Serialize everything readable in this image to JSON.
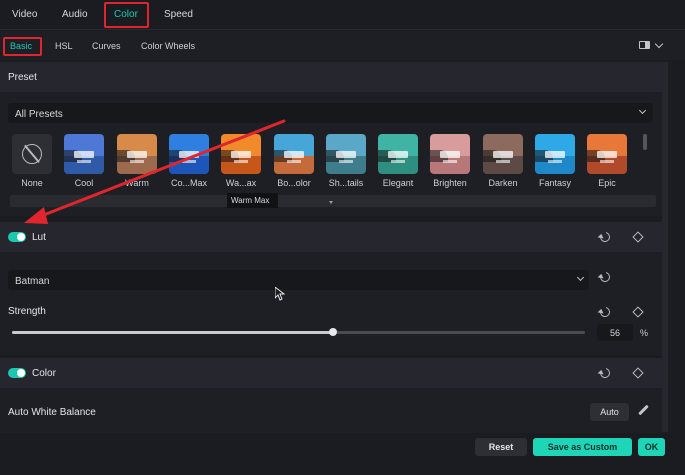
{
  "top_tabs": [
    "Video",
    "Audio",
    "Color",
    "Speed"
  ],
  "sub_tabs": [
    "Basic",
    "HSL",
    "Curves",
    "Color Wheels"
  ],
  "preset_section": {
    "title": "Preset",
    "dropdown_value": "All Presets",
    "presets": [
      {
        "name": "None"
      },
      {
        "name": "Cool",
        "sky": "#4d78d6",
        "sea": "#2f5aa8"
      },
      {
        "name": "Warm",
        "sky": "#d88a4a",
        "sea": "#9e6a4e"
      },
      {
        "name": "Co...Max",
        "sky": "#2f7fe0",
        "sea": "#1d56b8"
      },
      {
        "name": "Wa...ax",
        "sky": "#f08a2a",
        "sea": "#c7561a"
      },
      {
        "name": "Bo...olor",
        "sky": "#46a6d8",
        "sea": "#c56a3a"
      },
      {
        "name": "Sh...tails",
        "sky": "#5aa7c8",
        "sea": "#3e7e8c"
      },
      {
        "name": "Elegant",
        "sky": "#3fb4a4",
        "sea": "#2e8f80"
      },
      {
        "name": "Brighten",
        "sky": "#d89c9c",
        "sea": "#b8787a"
      },
      {
        "name": "Darken",
        "sky": "#8c6a5e",
        "sea": "#5e4a44"
      },
      {
        "name": "Fantasy",
        "sky": "#2fa8e8",
        "sea": "#1e88c8"
      },
      {
        "name": "Epic",
        "sky": "#e8783a",
        "sea": "#b04a2a"
      }
    ],
    "tooltip": "Warm Max"
  },
  "lut_section": {
    "title": "Lut",
    "enabled": true,
    "dropdown_value": "Batman",
    "strength_label": "Strength",
    "strength_value": "56",
    "strength_unit": "%",
    "strength_level": 0.56
  },
  "color_section": {
    "title": "Color",
    "enabled": true,
    "awb_label": "Auto White Balance",
    "auto_button": "Auto"
  },
  "footer": {
    "reset": "Reset",
    "save_custom": "Save as Custom",
    "ok": "OK"
  },
  "colors": {
    "accent": "#1ec8b0",
    "annotation_red": "#e0262c"
  }
}
